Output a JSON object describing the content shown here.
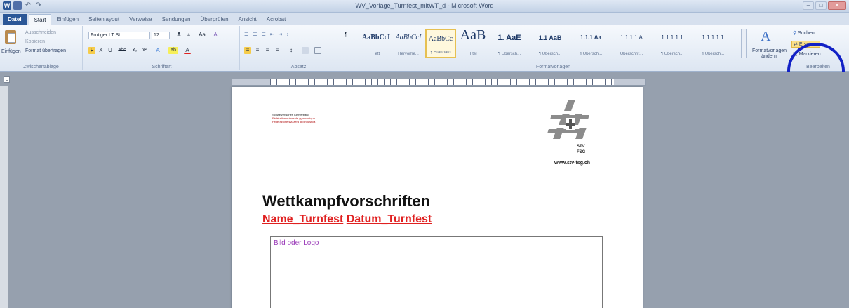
{
  "window": {
    "title": "WV_Vorlage_Turnfest_mitWT_d - Microsoft Word",
    "app_letter": "W",
    "qat_undo": "↶",
    "qat_redo": "↷",
    "controls": [
      "–",
      "□",
      "✕"
    ]
  },
  "tabs": [
    "Datei",
    "Start",
    "Einfügen",
    "Seitenlayout",
    "Verweise",
    "Sendungen",
    "Überprüfen",
    "Ansicht",
    "Acrobat"
  ],
  "ribbon": {
    "clipboard": {
      "paste_label": "Einfügen",
      "cut": "Ausschneiden",
      "copy": "Kopieren",
      "format_painter": "Format übertragen",
      "group_label": "Zwischenablage"
    },
    "font": {
      "font_name": "Frutiger LT St",
      "font_size": "12",
      "group_label": "Schriftart",
      "bold": "F",
      "italic": "K",
      "underline": "U",
      "strike": "abc",
      "sub": "x₂",
      "sup": "x²",
      "grow": "A",
      "shrink": "A",
      "case": "Aa",
      "clear": "A",
      "highlight": "ab",
      "color": "A"
    },
    "paragraph": {
      "group_label": "Absatz",
      "pilcrow": "¶"
    },
    "styles": {
      "group_label": "Formatvorlagen",
      "items": [
        {
          "sample": "AaBbCcI",
          "name": "Fett"
        },
        {
          "sample": "AaBbCcI",
          "name": "Hervorhe..."
        },
        {
          "sample": "AaBbCc",
          "name": "¶ Standard"
        },
        {
          "sample": "AaB",
          "name": "Titel"
        },
        {
          "sample": "1. AaE",
          "name": "¶ Übersch..."
        },
        {
          "sample": "1.1 AaB",
          "name": "¶ Übersch..."
        },
        {
          "sample": "1.1.1 Aa",
          "name": "¶ Übersch..."
        },
        {
          "sample": "1.1.1.1 A",
          "name": "Überschrif..."
        },
        {
          "sample": "1.1.1.1.1",
          "name": "¶ Übersch..."
        },
        {
          "sample": "1.1.1.1.1",
          "name": "¶ Übersch..."
        }
      ],
      "change_styles": "Formatvorlagen ändern"
    },
    "editing": {
      "group_label": "Bearbeiten",
      "find": "Suchen",
      "replace": "Ersetzen",
      "select": "Markieren"
    }
  },
  "document": {
    "header_lines": [
      "Schweizerischer Turnverband",
      "Fédération suisse de gymnastique",
      "Federazione svizzera di ginnastica"
    ],
    "logo_text": "STV FSG",
    "website": "www.stv-fsg.ch",
    "title": "Wettkampfvorschriften",
    "subtitle_parts": [
      "Name_Turnfest",
      "Datum_Turnfest"
    ],
    "image_placeholder": "Bild oder Logo"
  },
  "colors": {
    "file_tab": "#2b5797",
    "annotation_circle": "#1221c6",
    "subtitle_red": "#e02020",
    "header_line_red": "#b01010",
    "placeholder_purple": "#9a3ab8",
    "selected_style": "#e6c052"
  }
}
